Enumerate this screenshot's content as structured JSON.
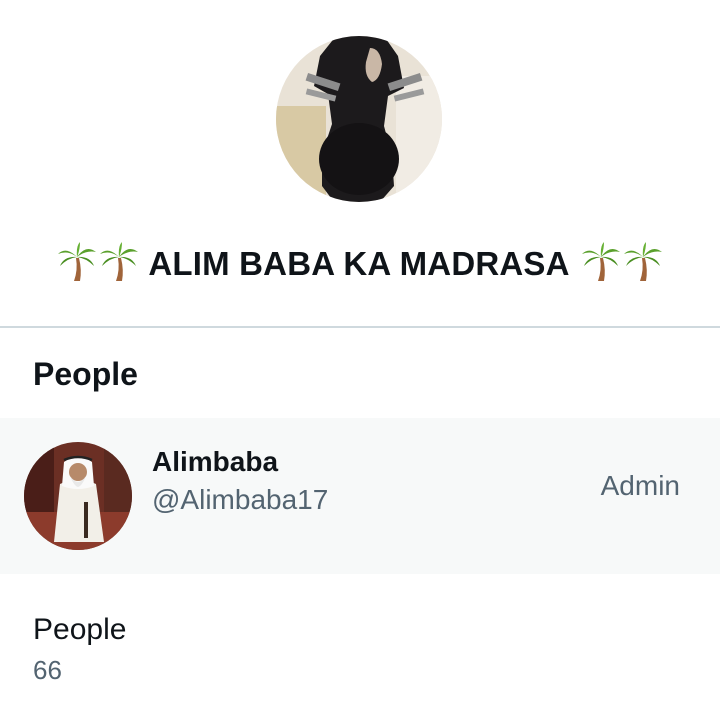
{
  "group": {
    "avatar_icon": "group-avatar-photo",
    "title_emoji": "palm-tree-icon",
    "title": "ALIM BABA KA MADRASA"
  },
  "people_section": {
    "heading": "People",
    "members": [
      {
        "display_name": "Alimbaba",
        "handle": "@Alimbaba17",
        "role": "Admin",
        "avatar_icon": "member-avatar-photo"
      }
    ]
  },
  "stats": {
    "people_label": "People",
    "people_count": "66"
  },
  "colors": {
    "text_primary": "#0f1419",
    "text_secondary": "#536471",
    "row_highlight": "#f7f9f9",
    "divider": "#cfd9de"
  }
}
